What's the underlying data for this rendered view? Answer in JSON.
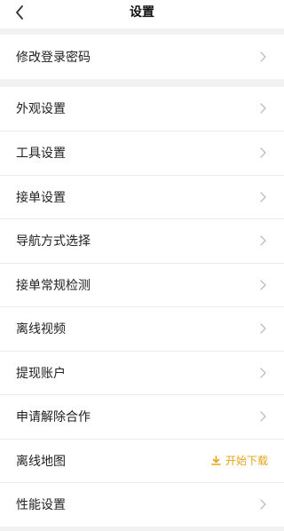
{
  "header": {
    "title": "设置"
  },
  "groups": [
    {
      "items": [
        {
          "label": "修改登录密码"
        }
      ]
    },
    {
      "items": [
        {
          "label": "外观设置"
        },
        {
          "label": "工具设置"
        },
        {
          "label": "接单设置"
        },
        {
          "label": "导航方式选择"
        },
        {
          "label": "接单常规检测"
        },
        {
          "label": "离线视频"
        },
        {
          "label": "提现账户"
        },
        {
          "label": "申请解除合作"
        },
        {
          "label": "离线地图",
          "action_label": "开始下载"
        },
        {
          "label": "性能设置"
        }
      ]
    }
  ],
  "colors": {
    "accent": "#e8a418",
    "background": "#f2f2f2",
    "chevron": "#bdbdbd"
  },
  "icons": {
    "back": "back-arrow-icon",
    "row": "chevron-right-icon",
    "download": "download-icon"
  }
}
